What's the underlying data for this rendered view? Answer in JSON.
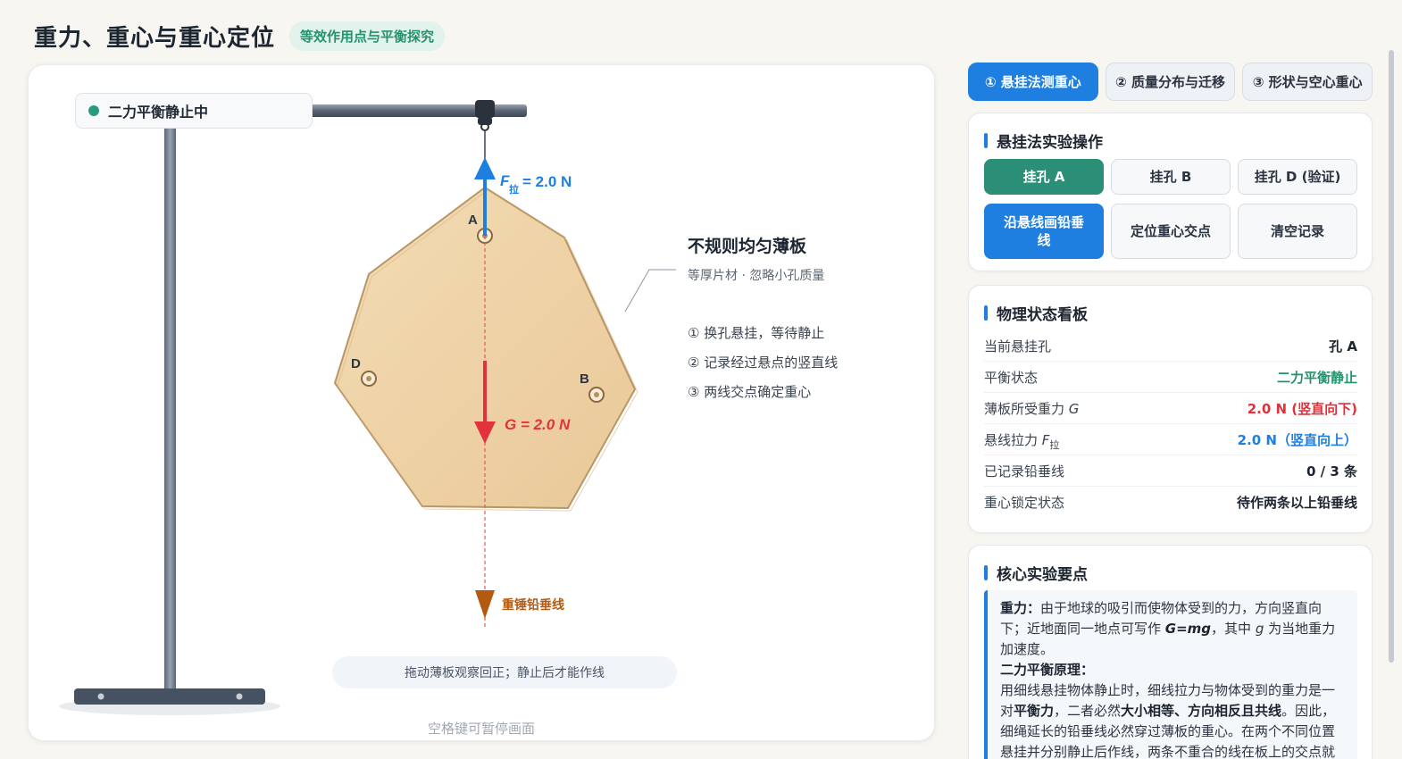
{
  "header": {
    "title": "重力、重心与重心定位",
    "subtitle": "等效作用点与平衡探究"
  },
  "stage": {
    "status": "二力平衡静止中",
    "plate_title": "不规则均匀薄板",
    "plate_subtitle": "等厚片材 · 忽略小孔质量",
    "steps": [
      "① 换孔悬挂，等待静止",
      "② 记录经过悬点的竖直线",
      "③ 两线交点确定重心"
    ],
    "holes": [
      "A",
      "B",
      "D"
    ],
    "tension_label": "= 2.0 N",
    "tension_symbol": "F",
    "tension_subscript": "拉",
    "gravity_label": "G = 2.0 N",
    "plumb_label": "重锤铅垂线",
    "drag_hint": "拖动薄板观察回正；静止后才能作线",
    "footer_hint": "空格键可暂停画面",
    "colors": {
      "tension": "#1f7fe0",
      "gravity": "#e2323c",
      "plumb": "#b35a10",
      "plate": "#f1d6ac"
    }
  },
  "tabs": [
    "① 悬挂法测重心",
    "② 质量分布与迁移",
    "③ 形状与空心重心"
  ],
  "ops": {
    "title": "悬挂法实验操作",
    "hang_a": "挂孔 A",
    "hang_b": "挂孔 B",
    "hang_d": "挂孔 D (验证)",
    "draw_line": "沿悬线画铅垂线",
    "locate": "定位重心交点",
    "clear": "清空记录"
  },
  "state": {
    "title": "物理状态看板",
    "rows": [
      {
        "label": "当前悬挂孔",
        "value": "孔 A"
      },
      {
        "label": "平衡状态",
        "value": "二力平衡静止"
      },
      {
        "label_text": "薄板所受重力 ",
        "label_sym": "G",
        "value": "2.0 N (竖直向下)"
      },
      {
        "label_text": "悬线拉力 ",
        "label_sym": "F",
        "label_sub": "拉",
        "value": "2.0 N（竖直向上）"
      },
      {
        "label": "已记录铅垂线",
        "value": "0 / 3 条"
      },
      {
        "label": "重心锁定状态",
        "value": "待作两条以上铅垂线"
      }
    ]
  },
  "points": {
    "title": "核心实验要点",
    "gravity_term": "重力：",
    "gravity_text_1": "由于地球的吸引而使物体受到的力，方向竖直向下；近地面同一地点可写作 ",
    "gravity_formula": "G=mg",
    "gravity_text_2": "，其中 ",
    "gravity_g": "g",
    "gravity_text_3": " 为当地重力加速度。",
    "balance_term": "二力平衡原理：",
    "balance_text_1": "用细线悬挂物体静止时，细线拉力与物体受到的重力是一对",
    "balance_b1": "平衡力",
    "balance_text_2": "，二者必然",
    "balance_b2": "大小相等、方向相反且共线",
    "balance_text_3": "。因此，细绳延长的铅垂线必然穿过薄板的重心。在两个不同位置悬挂并分别静止后作线，两条不重合的线在板上的交点就是重心。"
  }
}
